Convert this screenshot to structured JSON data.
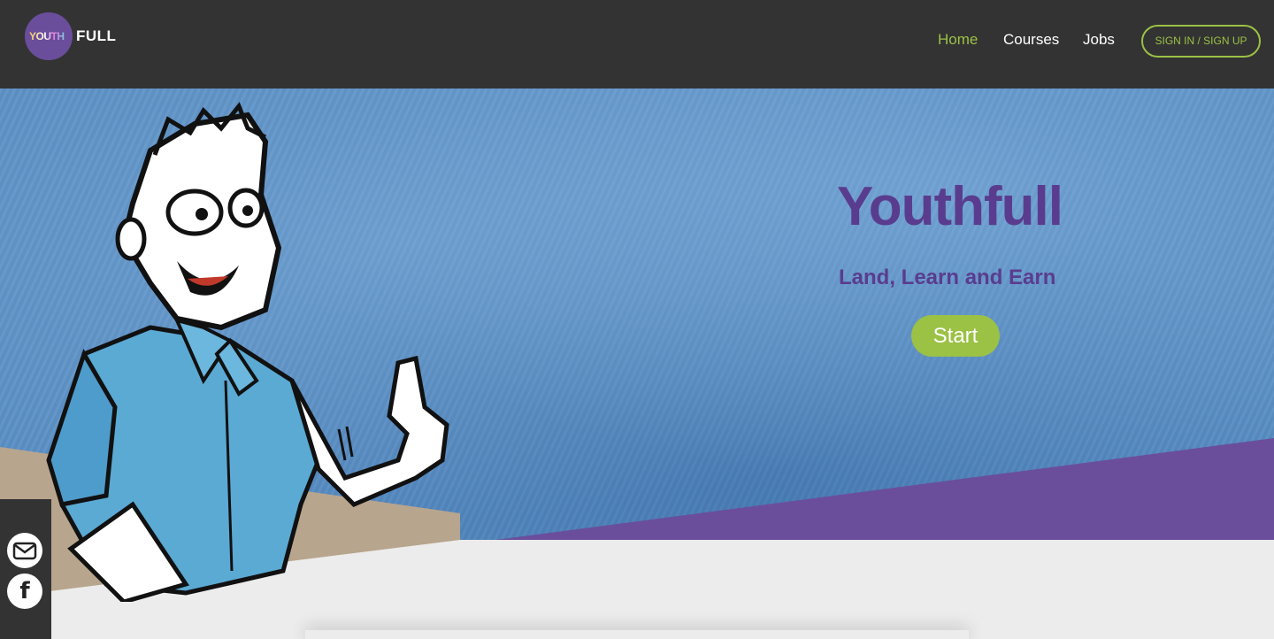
{
  "brand": {
    "logo_youth": "YOUTH",
    "logo_full": "FULL"
  },
  "nav": {
    "home": "Home",
    "courses": "Courses",
    "jobs": "Jobs",
    "sign_in": "SIGN IN / SIGN UP"
  },
  "hero": {
    "title": "Youthfull",
    "subtitle": "Land, Learn and Earn",
    "start": "Start"
  },
  "social": {
    "mail": "mail-icon",
    "facebook": "facebook-icon",
    "facebook_glyph": "f"
  },
  "colors": {
    "accent_green": "#9bc145",
    "brand_purple": "#5a3c8f",
    "band_purple": "#6a4e9c",
    "header_dark": "#333333"
  }
}
